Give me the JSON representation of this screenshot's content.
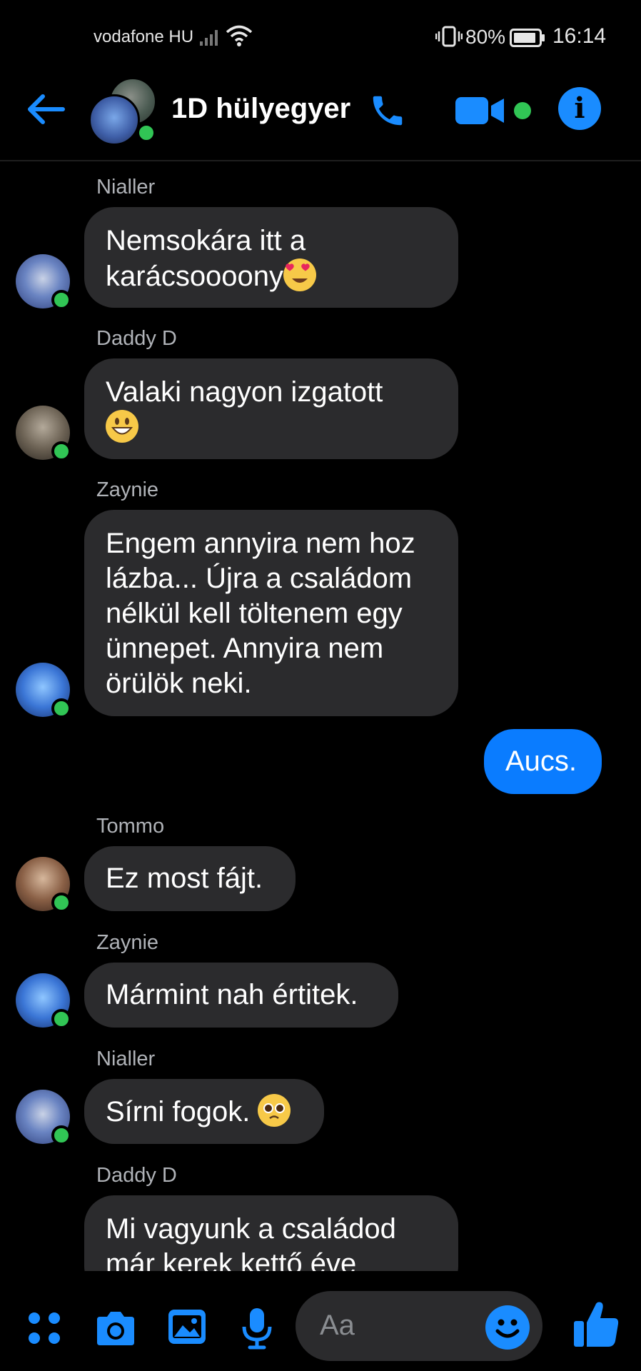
{
  "status_bar": {
    "carrier": "vodafone HU",
    "battery": "80%",
    "time": "16:14"
  },
  "header": {
    "title": "1D hülyegyer",
    "back_icon": "back-arrow-icon",
    "call_icon": "phone-icon",
    "video_icon": "video-camera-icon",
    "info_icon": "info-icon",
    "accent_color": "#1a8cff",
    "online_color": "#31c555"
  },
  "messages": [
    {
      "sender": "Nialler",
      "text": "Nemsokára itt a karácsoooony",
      "emoji": "heart-eyes"
    },
    {
      "sender": "Daddy D",
      "text": "Valaki nagyon izgatott",
      "emoji": "grinning"
    },
    {
      "sender": "Zaynie",
      "text": "Engem annyira nem hoz lázba... Újra a családom nélkül kell töltenem egy ünnepet. Annyira nem örülök neki."
    },
    {
      "sender": "",
      "text": "Aucs.",
      "outgoing": true
    },
    {
      "sender": "Tommo",
      "text": "Ez most fájt."
    },
    {
      "sender": "Zaynie",
      "text": "Mármint nah értitek."
    },
    {
      "sender": "Nialler",
      "text": "Sírni fogok.",
      "emoji": "pleading"
    },
    {
      "sender": "Daddy D",
      "text": "Mi vagyunk a családod már kerek kettő éve"
    }
  ],
  "composer": {
    "placeholder": "Aa",
    "icons": [
      "menu-dots-icon",
      "camera-icon",
      "gallery-icon",
      "microphone-icon",
      "emoji-icon",
      "thumbs-up-icon"
    ]
  },
  "colors": {
    "bubble_incoming": "#2b2b2d",
    "bubble_outgoing": "#0a7cff",
    "background": "#000000"
  }
}
